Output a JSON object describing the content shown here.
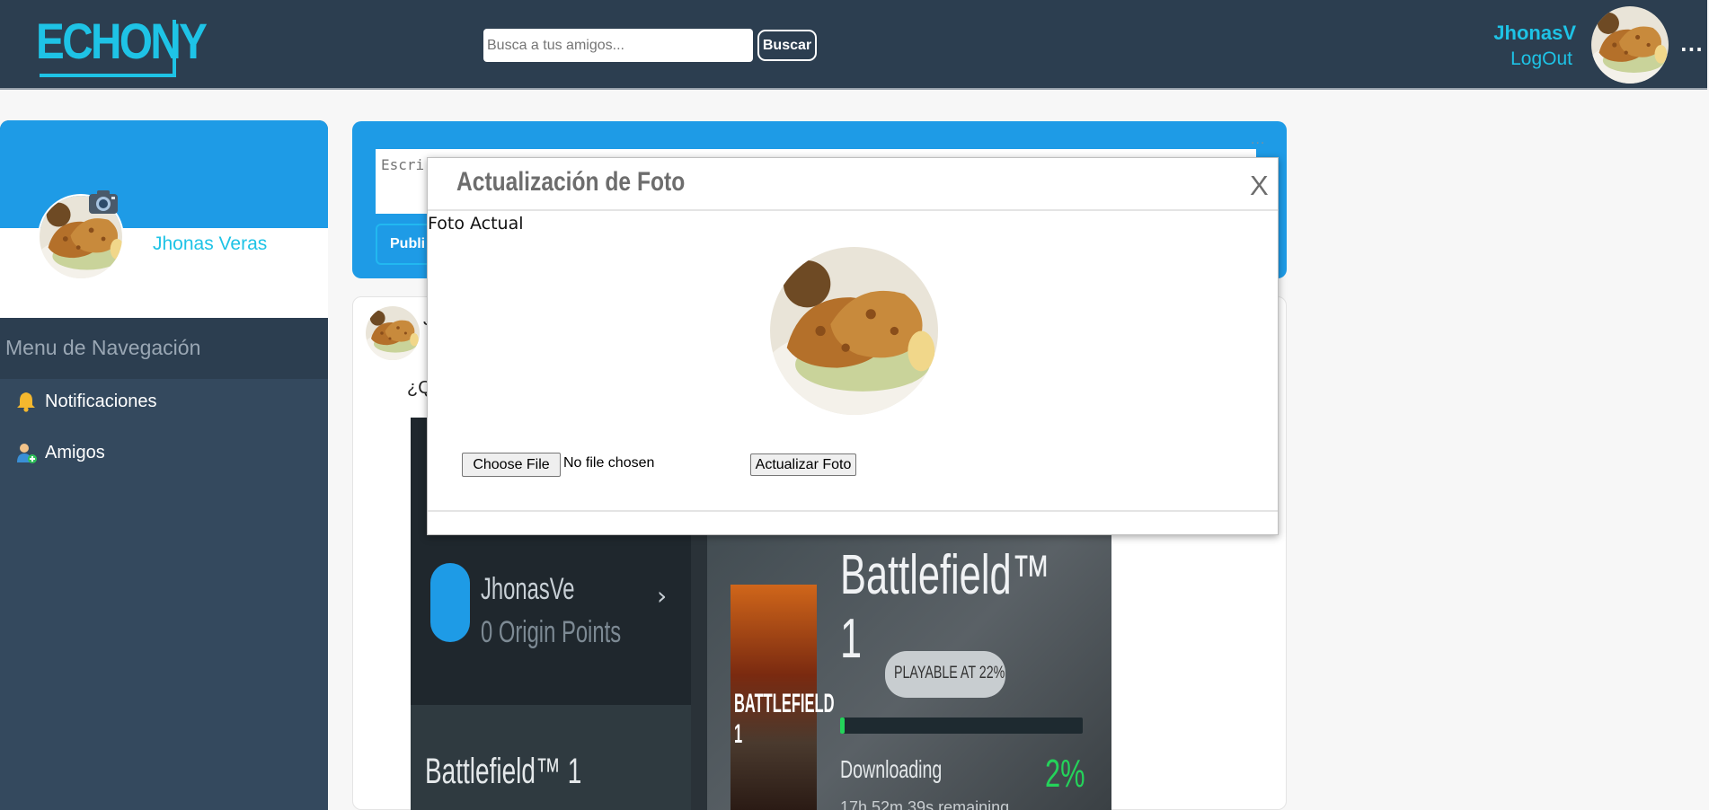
{
  "header": {
    "logo_text": "ECHONY",
    "search_placeholder": "Busca a tus amigos...",
    "search_button": "Buscar",
    "username": "JhonasV",
    "logout_label": "LogOut",
    "more_label": "..."
  },
  "sidebar": {
    "profile_name": "Jhonas Veras",
    "menu_title": "Menu de Navegación",
    "items": [
      {
        "label": "Notificaciones",
        "icon": "bell-icon"
      },
      {
        "label": "Amigos",
        "icon": "add-friend-icon"
      }
    ]
  },
  "composer": {
    "placeholder": "Escri",
    "button_label": "Publi",
    "more_label": "..."
  },
  "post": {
    "author": "J",
    "text": "¿Q",
    "image": {
      "origin_username": "JhonasVe",
      "origin_points": "0 Origin Points",
      "origin_game": "Battlefield™ 1",
      "game_title": "Battlefield™ 1",
      "cover_title": "BATTLEFIELD 1",
      "playable_badge": "PLAYABLE AT 22%",
      "status": "Downloading",
      "download_percent": "2%",
      "progress": 0.02,
      "remaining": "17h 52m 39s remaining"
    }
  },
  "modal": {
    "title": "Actualización de Foto",
    "close_label": "X",
    "current_label": "Foto Actual",
    "file_button": "Choose File",
    "file_status": "No file chosen",
    "submit_button": "Actualizar Foto"
  },
  "colors": {
    "topbar": "#2c3e50",
    "accent": "#1ec3e6",
    "blue": "#1e9be6",
    "sidebar": "#34495e"
  }
}
